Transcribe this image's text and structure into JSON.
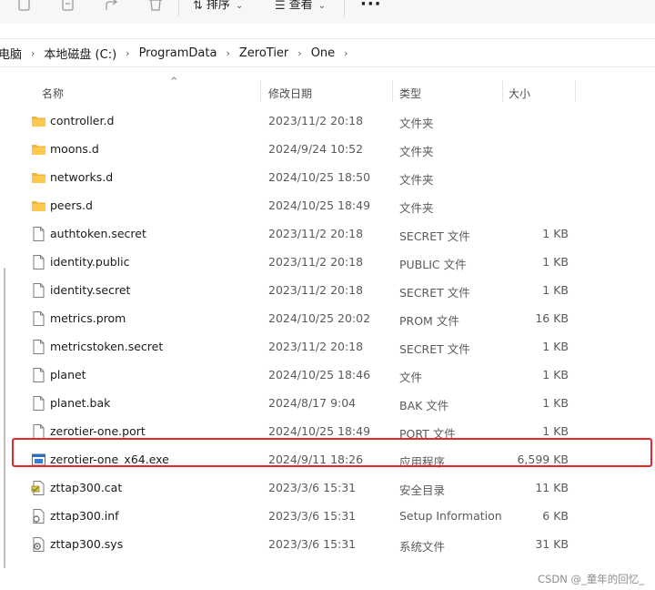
{
  "toolbar": {
    "sort_label": "排序",
    "view_label": "查看",
    "more_label": "···"
  },
  "breadcrumb": [
    "电脑",
    "本地磁盘 (C:)",
    "ProgramData",
    "ZeroTier",
    "One"
  ],
  "columns": {
    "name": "名称",
    "date": "修改日期",
    "type": "类型",
    "size": "大小"
  },
  "files": [
    {
      "name": "controller.d",
      "date": "2023/11/2 20:18",
      "type": "文件夹",
      "size": "",
      "icon": "folder-icon"
    },
    {
      "name": "moons.d",
      "date": "2024/9/24 10:52",
      "type": "文件夹",
      "size": "",
      "icon": "folder-icon"
    },
    {
      "name": "networks.d",
      "date": "2024/10/25 18:50",
      "type": "文件夹",
      "size": "",
      "icon": "folder-icon"
    },
    {
      "name": "peers.d",
      "date": "2024/10/25 18:49",
      "type": "文件夹",
      "size": "",
      "icon": "folder-icon"
    },
    {
      "name": "authtoken.secret",
      "date": "2023/11/2 20:18",
      "type": "SECRET 文件",
      "size": "1 KB",
      "icon": "file-icon"
    },
    {
      "name": "identity.public",
      "date": "2023/11/2 20:18",
      "type": "PUBLIC 文件",
      "size": "1 KB",
      "icon": "file-icon"
    },
    {
      "name": "identity.secret",
      "date": "2023/11/2 20:18",
      "type": "SECRET 文件",
      "size": "1 KB",
      "icon": "file-icon"
    },
    {
      "name": "metrics.prom",
      "date": "2024/10/25 20:02",
      "type": "PROM 文件",
      "size": "16 KB",
      "icon": "file-icon"
    },
    {
      "name": "metricstoken.secret",
      "date": "2023/11/2 20:18",
      "type": "SECRET 文件",
      "size": "1 KB",
      "icon": "file-icon"
    },
    {
      "name": "planet",
      "date": "2024/10/25 18:46",
      "type": "文件",
      "size": "1 KB",
      "icon": "file-icon"
    },
    {
      "name": "planet.bak",
      "date": "2024/8/17 9:04",
      "type": "BAK 文件",
      "size": "1 KB",
      "icon": "file-icon"
    },
    {
      "name": "zerotier-one.port",
      "date": "2024/10/25 18:49",
      "type": "PORT 文件",
      "size": "1 KB",
      "icon": "file-icon"
    },
    {
      "name": "zerotier-one_x64.exe",
      "date": "2024/9/11 18:26",
      "type": "应用程序",
      "size": "6,599 KB",
      "icon": "exe-icon"
    },
    {
      "name": "zttap300.cat",
      "date": "2023/3/6 15:31",
      "type": "安全目录",
      "size": "11 KB",
      "icon": "cat-icon"
    },
    {
      "name": "zttap300.inf",
      "date": "2023/3/6 15:31",
      "type": "Setup Information",
      "size": "6 KB",
      "icon": "inf-icon"
    },
    {
      "name": "zttap300.sys",
      "date": "2023/3/6 15:31",
      "type": "系统文件",
      "size": "31 KB",
      "icon": "sys-icon"
    }
  ],
  "watermark": "CSDN @_童年的回忆_"
}
